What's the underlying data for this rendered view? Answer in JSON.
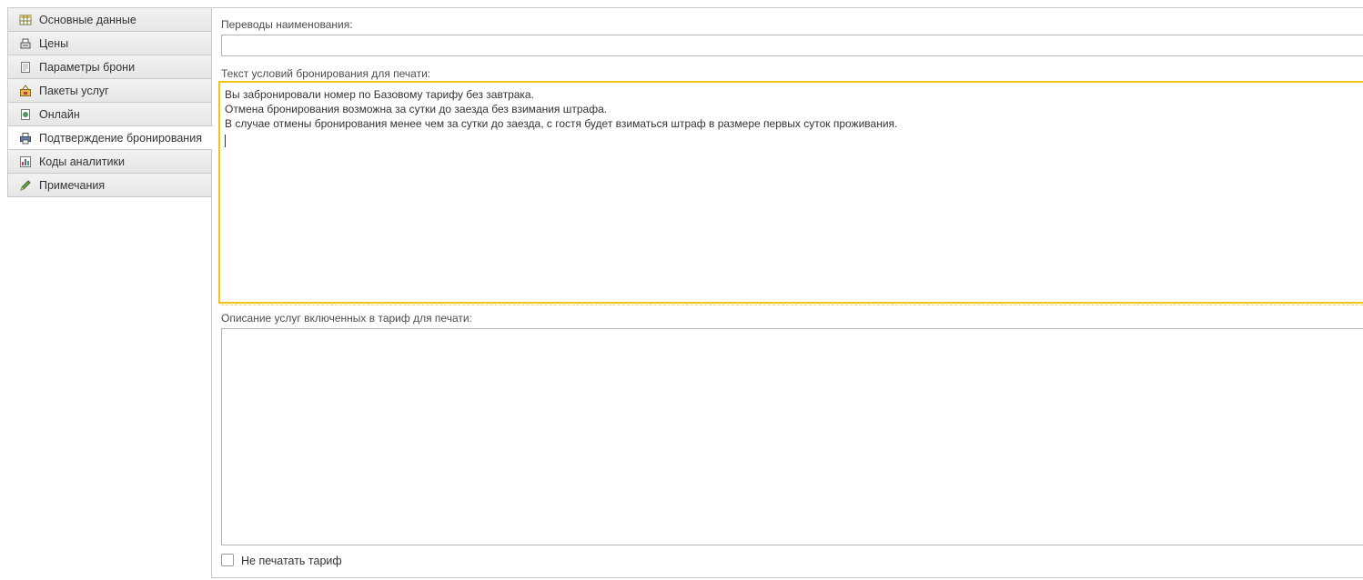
{
  "tabs": [
    {
      "label": "Основные данные",
      "icon": "table-icon"
    },
    {
      "label": "Цены",
      "icon": "cash-register-icon"
    },
    {
      "label": "Параметры брони",
      "icon": "document-icon"
    },
    {
      "label": "Пакеты услуг",
      "icon": "package-icon"
    },
    {
      "label": "Онлайн",
      "icon": "online-icon"
    },
    {
      "label": "Подтверждение бронирования",
      "icon": "printer-icon"
    },
    {
      "label": "Коды аналитики",
      "icon": "chart-icon"
    },
    {
      "label": "Примечания",
      "icon": "pencil-icon"
    }
  ],
  "active_tab": "Подтверждение бронирования",
  "form": {
    "translations_label": "Переводы наименования:",
    "translations_value": "",
    "conditions_label": "Текст условий бронирования для печати:",
    "conditions_value": "Вы забронировали номер по Базовому тарифу без завтрака.\nОтмена бронирования возможна за сутки до заезда без взимания штрафа.\nВ случае отмены бронирования менее чем за сутки до заезда, с гостя будет взиматься штраф в размере первых суток проживания.\n",
    "services_label": "Описание услуг включенных в тариф для печати:",
    "services_value": "",
    "no_print_label": "Не печатать тариф"
  },
  "colors": {
    "focus": "#f2c318",
    "border": "#b3b3b3"
  }
}
